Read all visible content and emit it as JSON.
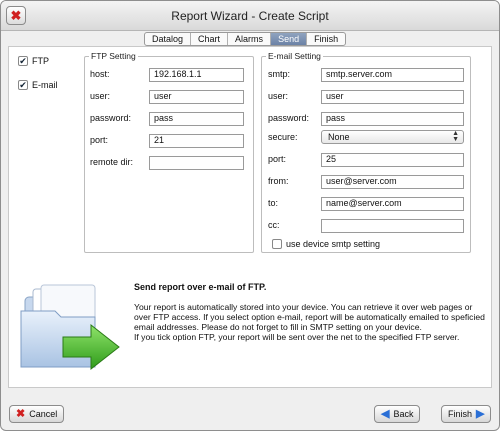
{
  "window": {
    "title": "Report Wizard - Create Script"
  },
  "tabs": [
    {
      "label": "Datalog",
      "active": false
    },
    {
      "label": "Chart",
      "active": false
    },
    {
      "label": "Alarms",
      "active": false
    },
    {
      "label": "Send",
      "active": true
    },
    {
      "label": "Finish",
      "active": false
    }
  ],
  "options": {
    "ftp": {
      "label": "FTP",
      "checked": true
    },
    "email": {
      "label": "E-mail",
      "checked": true
    }
  },
  "ftp_setting": {
    "legend": "FTP Setting",
    "host": {
      "label": "host:",
      "value": "192.168.1.1"
    },
    "user": {
      "label": "user:",
      "value": "user"
    },
    "password": {
      "label": "password:",
      "value": "pass"
    },
    "port": {
      "label": "port:",
      "value": "21"
    },
    "remote_dir": {
      "label": "remote dir:",
      "value": ""
    }
  },
  "email_setting": {
    "legend": "E-mail Setting",
    "smtp": {
      "label": "smtp:",
      "value": "smtp.server.com"
    },
    "user": {
      "label": "user:",
      "value": "user"
    },
    "password": {
      "label": "password:",
      "value": "pass"
    },
    "secure": {
      "label": "secure:",
      "value": "None"
    },
    "port": {
      "label": "port:",
      "value": "25"
    },
    "from": {
      "label": "from:",
      "value": "user@server.com"
    },
    "to": {
      "label": "to:",
      "value": "name@server.com"
    },
    "cc": {
      "label": "cc:",
      "value": ""
    },
    "use_device_smtp": {
      "label": "use device smtp setting",
      "checked": false
    }
  },
  "info": {
    "title": "Send report over e-mail of FTP.",
    "paragraph1": "Your report is automatically stored into your device. You can retrieve it over web pages or over FTP access. If you select option e-mail, report will be automatically emailed to speficied email addresses. Please do not forget to fill in SMTP setting on your device.",
    "paragraph2": "If you tick option FTP, your report will be sent over the net to the specified FTP server."
  },
  "buttons": {
    "cancel": "Cancel",
    "back": "Back",
    "finish": "Finish"
  },
  "colors": {
    "accent_tab": "#7890b2",
    "cancel_red": "#d02020",
    "arrow_blue": "#2a6fd6",
    "arrow_green": "#4dbb2a"
  }
}
